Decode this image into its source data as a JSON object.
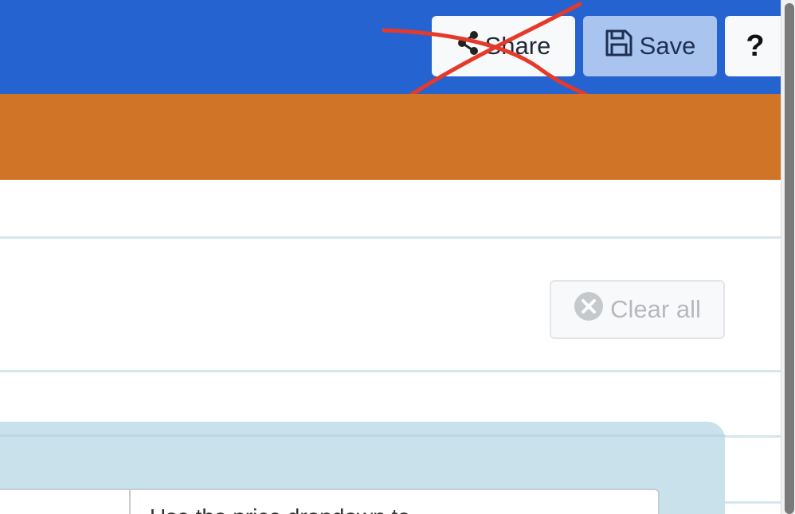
{
  "header": {
    "share_label": "Share",
    "save_label": "Save",
    "help_label": "?",
    "bar_color": "#2563d0",
    "band_color": "#d07428"
  },
  "toolbar": {
    "clear_all_label": "Clear all",
    "clear_all_disabled": true
  },
  "info_card": {
    "text": "Use the price dropdown to"
  },
  "icons": {
    "share": "share-icon",
    "save": "floppy-disk-icon",
    "clear": "close-circle-icon"
  }
}
